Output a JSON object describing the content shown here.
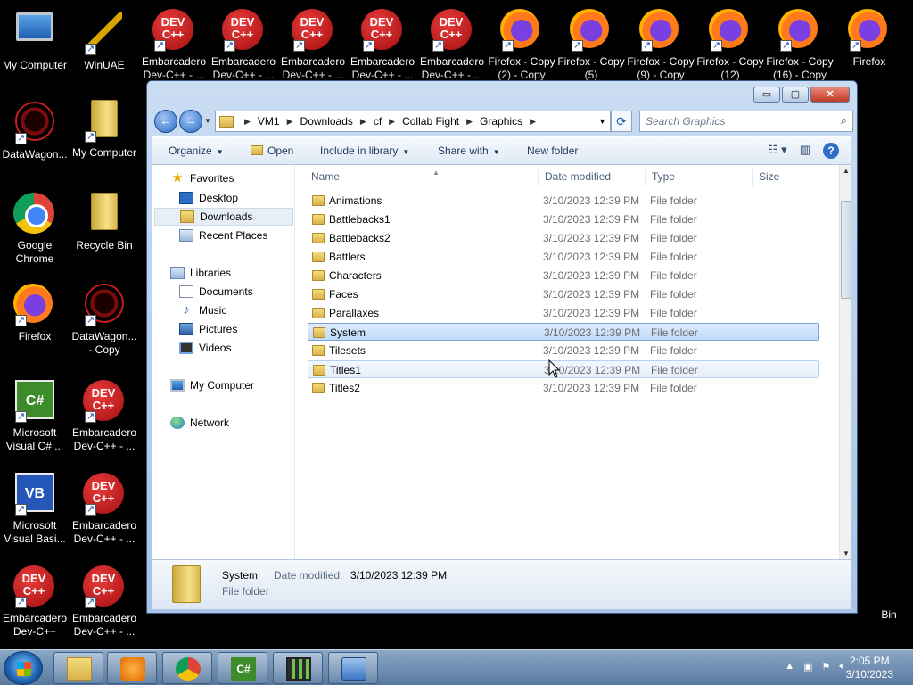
{
  "desktop": {
    "icons": {
      "c0r0": "My Computer",
      "c1r0": "WinUAE",
      "c2r0": "Embarcadero Dev-C++ - ...",
      "c3r0": "Embarcadero Dev-C++ - ...",
      "c4r0": "Embarcadero Dev-C++ - ...",
      "c5r0": "Embarcadero Dev-C++ - ...",
      "c6r0": "Embarcadero Dev-C++ - ...",
      "c7r0": "Firefox - Copy (2) - Copy",
      "c8r0": "Firefox - Copy (5)",
      "c9r0": "Firefox - Copy (9) - Copy",
      "c10r0": "Firefox - Copy (12)",
      "c11r0": "Firefox - Copy (16) - Copy",
      "c12r0": "Firefox",
      "c0r1": "DataWagon...",
      "c1r1": "My Computer",
      "c0r2": "Google Chrome",
      "c1r2": "Recycle Bin",
      "c0r3": "Firefox",
      "c1r3": "DataWagon... - Copy",
      "c0r4": "Microsoft Visual C# ...",
      "c1r4": "Embarcadero Dev-C++ - ...",
      "c0r5": "Microsoft Visual Basi...",
      "c1r5": "Embarcadero Dev-C++ - ...",
      "c0r6": "Embarcadero Dev-C++",
      "c1r6": "Embarcadero Dev-C++ - ...",
      "dev_label": "DEV",
      "dev_plus": "C++",
      "vs_label": "C#",
      "vb_label": "VB",
      "bin_partial": "Bin"
    }
  },
  "window": {
    "caption": {
      "minimize": "▭",
      "maximize": "▢",
      "close": "✕"
    },
    "nav": {
      "back": "←",
      "forward": "→"
    },
    "breadcrumb": [
      "VM1",
      "Downloads",
      "cf",
      "Collab Fight",
      "Graphics"
    ],
    "search_placeholder": "Search Graphics",
    "toolbar": {
      "organize": "Organize",
      "open": "Open",
      "include_in_library": "Include in library",
      "share_with": "Share with",
      "new_folder": "New folder"
    },
    "navpane": {
      "favorites": "Favorites",
      "desktop": "Desktop",
      "downloads": "Downloads",
      "recent_places": "Recent Places",
      "libraries": "Libraries",
      "documents": "Documents",
      "music": "Music",
      "pictures": "Pictures",
      "videos": "Videos",
      "my_computer": "My Computer",
      "network": "Network"
    },
    "columns": {
      "name": "Name",
      "date_modified": "Date modified",
      "type": "Type",
      "size": "Size"
    },
    "files": [
      {
        "name": "Animations",
        "date": "3/10/2023 12:39 PM",
        "type": "File folder"
      },
      {
        "name": "Battlebacks1",
        "date": "3/10/2023 12:39 PM",
        "type": "File folder"
      },
      {
        "name": "Battlebacks2",
        "date": "3/10/2023 12:39 PM",
        "type": "File folder"
      },
      {
        "name": "Battlers",
        "date": "3/10/2023 12:39 PM",
        "type": "File folder"
      },
      {
        "name": "Characters",
        "date": "3/10/2023 12:39 PM",
        "type": "File folder"
      },
      {
        "name": "Faces",
        "date": "3/10/2023 12:39 PM",
        "type": "File folder"
      },
      {
        "name": "Parallaxes",
        "date": "3/10/2023 12:39 PM",
        "type": "File folder"
      },
      {
        "name": "System",
        "date": "3/10/2023 12:39 PM",
        "type": "File folder"
      },
      {
        "name": "Tilesets",
        "date": "3/10/2023 12:39 PM",
        "type": "File folder"
      },
      {
        "name": "Titles1",
        "date": "3/10/2023 12:39 PM",
        "type": "File folder"
      },
      {
        "name": "Titles2",
        "date": "3/10/2023 12:39 PM",
        "type": "File folder"
      }
    ],
    "selected_index": 7,
    "hovered_index": 9,
    "details": {
      "name": "System",
      "date_label": "Date modified:",
      "date_value": "3/10/2023 12:39 PM",
      "type": "File folder"
    }
  },
  "taskbar": {
    "clock_time": "2:05 PM",
    "clock_date": "3/10/2023",
    "csharp_label": "C#"
  }
}
